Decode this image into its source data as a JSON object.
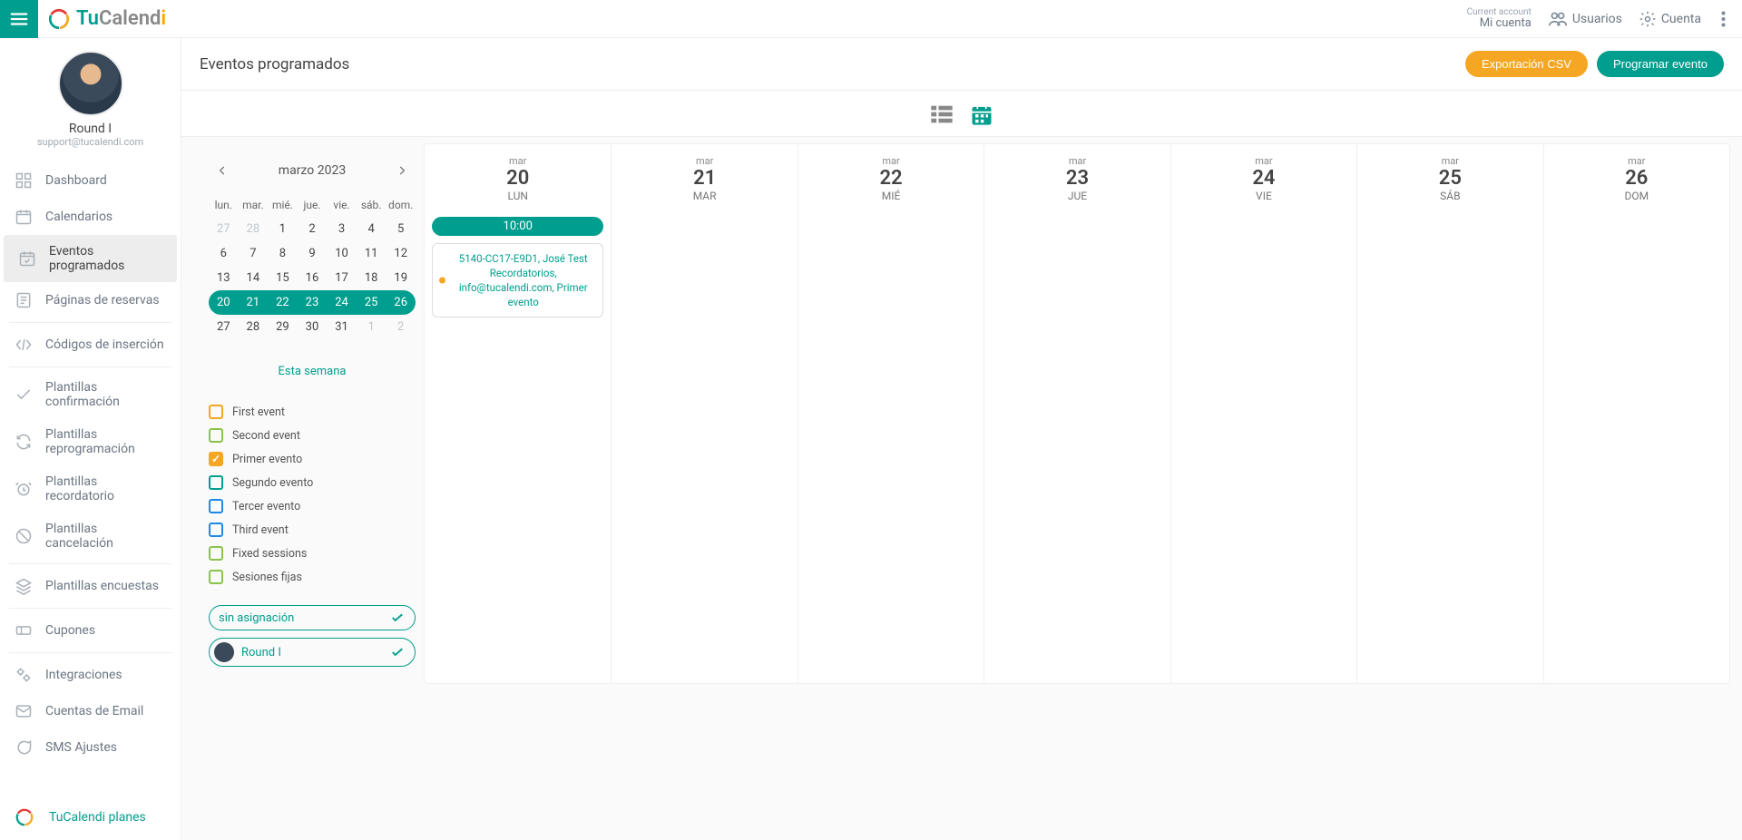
{
  "brand": {
    "p1": "Tu",
    "p2": "Calend",
    "p3": "i"
  },
  "topbar": {
    "current_account_label": "Current account",
    "current_account_value": "Mi cuenta",
    "users_label": "Usuarios",
    "account_label": "Cuenta"
  },
  "profile": {
    "name": "Round I",
    "email": "support@tucalendi.com"
  },
  "nav": {
    "dashboard": "Dashboard",
    "calendars": "Calendarios",
    "scheduled": "Eventos programados",
    "booking_pages": "Páginas de reservas",
    "embed_codes": "Códigos de inserción",
    "tpl_confirm": "Plantillas confirmación",
    "tpl_reprog": "Plantillas reprogramación",
    "tpl_remind": "Plantillas recordatorio",
    "tpl_cancel": "Plantillas cancelación",
    "tpl_surveys": "Plantillas encuestas",
    "coupons": "Cupones",
    "integrations": "Integraciones",
    "email_accounts": "Cuentas de Email",
    "sms_settings": "SMS Ajustes"
  },
  "footer_link": "TuCalendi planes",
  "page": {
    "title": "Eventos programados",
    "export_btn": "Exportación CSV",
    "schedule_btn": "Programar evento"
  },
  "mini_cal": {
    "month_label": "marzo 2023",
    "dow": [
      "lun.",
      "mar.",
      "mié.",
      "jue.",
      "vie.",
      "sáb.",
      "dom."
    ],
    "this_week": "Esta semana",
    "weeks": [
      {
        "days": [
          "27",
          "28",
          "1",
          "2",
          "3",
          "4",
          "5"
        ],
        "other_mask": [
          true,
          true,
          false,
          false,
          false,
          false,
          false
        ],
        "selected": false
      },
      {
        "days": [
          "6",
          "7",
          "8",
          "9",
          "10",
          "11",
          "12"
        ],
        "other_mask": [
          false,
          false,
          false,
          false,
          false,
          false,
          false
        ],
        "selected": false
      },
      {
        "days": [
          "13",
          "14",
          "15",
          "16",
          "17",
          "18",
          "19"
        ],
        "other_mask": [
          false,
          false,
          false,
          false,
          false,
          false,
          false
        ],
        "selected": false
      },
      {
        "days": [
          "20",
          "21",
          "22",
          "23",
          "24",
          "25",
          "26"
        ],
        "other_mask": [
          false,
          false,
          false,
          false,
          false,
          false,
          false
        ],
        "selected": true
      },
      {
        "days": [
          "27",
          "28",
          "29",
          "30",
          "31",
          "1",
          "2"
        ],
        "other_mask": [
          false,
          false,
          false,
          false,
          false,
          true,
          true
        ],
        "selected": false
      }
    ]
  },
  "filters": [
    {
      "label": "First event",
      "color": "#f5a623",
      "checked": false
    },
    {
      "label": "Second event",
      "color": "#8bc34a",
      "checked": false
    },
    {
      "label": "Primer evento",
      "color": "#f5a623",
      "checked": true
    },
    {
      "label": "Segundo evento",
      "color": "#009e8e",
      "checked": false
    },
    {
      "label": "Tercer evento",
      "color": "#1e88e5",
      "checked": false
    },
    {
      "label": "Third event",
      "color": "#1e88e5",
      "checked": false
    },
    {
      "label": "Fixed sessions",
      "color": "#8bc34a",
      "checked": false
    },
    {
      "label": "Sesiones fijas",
      "color": "#8bc34a",
      "checked": false
    }
  ],
  "user_chips": [
    {
      "label": "sin asignación",
      "has_avatar": false
    },
    {
      "label": "Round I",
      "has_avatar": true
    }
  ],
  "week": {
    "month_short": "mar",
    "days": [
      {
        "num": "20",
        "dow": "LUN"
      },
      {
        "num": "21",
        "dow": "MAR"
      },
      {
        "num": "22",
        "dow": "MIÉ"
      },
      {
        "num": "23",
        "dow": "JUE"
      },
      {
        "num": "24",
        "dow": "VIE"
      },
      {
        "num": "25",
        "dow": "SÁB"
      },
      {
        "num": "26",
        "dow": "DOM"
      }
    ],
    "events": [
      {
        "day_index": 0,
        "time": "10:00",
        "text": "5140-CC17-E9D1, José Test Recordatorios, info@tucalendi.com, Primer evento"
      }
    ]
  }
}
